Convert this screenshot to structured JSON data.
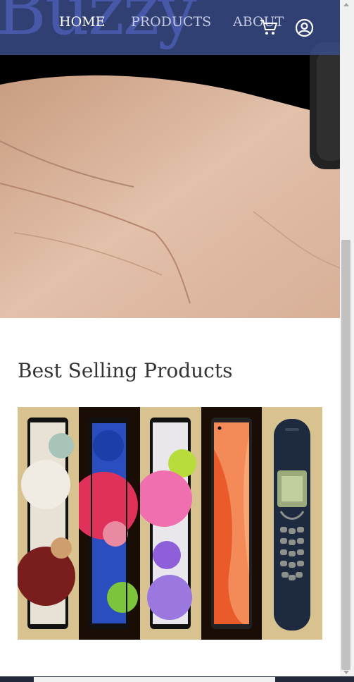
{
  "nav": {
    "brand": "Buzzy",
    "links": [
      {
        "label": "HOME",
        "active": true
      },
      {
        "label": "PRODUCTS",
        "active": false
      },
      {
        "label": "ABOUT",
        "active": false
      }
    ],
    "icons": [
      "cart-icon",
      "user-icon"
    ]
  },
  "hero": {
    "image": "wrist wearing a smartwatch"
  },
  "best_selling": {
    "title": "Best Selling Products",
    "products": [
      {
        "image": "phone-white-red-wallpaper",
        "background": "#d8c390"
      },
      {
        "image": "phone-pink-blue-wallpaper",
        "background": "#1a0d06"
      },
      {
        "image": "phone-purple-pink-wallpaper",
        "background": "#d8c390"
      },
      {
        "image": "phone-orange-wallpaper",
        "background": "#1a0d06"
      },
      {
        "image": "nokia-classic-phone",
        "background": "#d8c390"
      }
    ]
  },
  "colors": {
    "navbar": "#3c4e8c",
    "brand": "#4758a8",
    "text": "#333333"
  }
}
